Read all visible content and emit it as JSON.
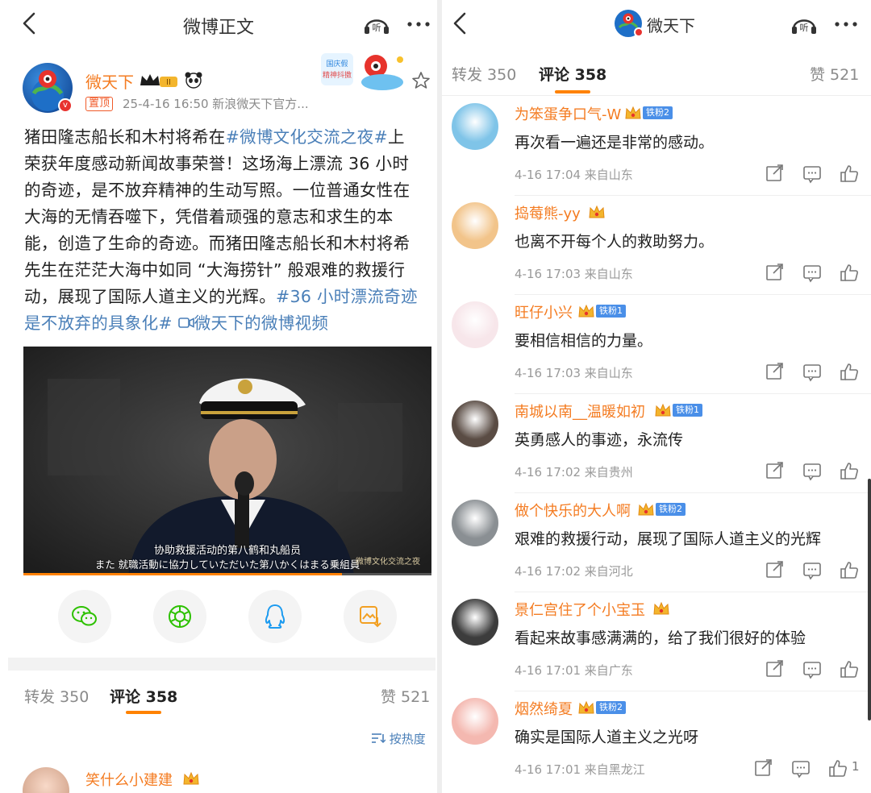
{
  "left": {
    "nav": {
      "title": "微博正文",
      "listen_label": "听"
    },
    "post": {
      "user": "微天下",
      "crown_level": "II",
      "pin_tag": "置顶",
      "meta": "25-4-16 16:50  新浪微天下官方...",
      "body_pre": "猪田隆志船长和木村将希在",
      "topic1": "#微博文化交流之夜#",
      "body_mid": "上荣获年度感动新闻故事荣誉！这场海上漂流 36 小时的奇迹，是不放弃精神的生动写照。一位普通女性在大海的无情吞噬下，凭借着顽强的意志和求生的本能，创造了生命的奇迹。而猪田隆志船长和木村将希先生在茫茫大海中如同 “大海捞针” 般艰难的救援行动，展现了国际人道主义的光辉。",
      "topic2": "#36 小时漂流奇迹是不放弃的具象化#",
      "video_link": "微天下的微博视频",
      "sticker_text": "国庆假 精神抖擞"
    },
    "video": {
      "subtitle_cn": "协助救援活动的第八鹤和丸船员",
      "subtitle_jp": "また 就職活動に協力していただいた第八かくはまる乗組員",
      "logo_text": "微博文化交流之夜",
      "progress": 0.78
    },
    "tabs": {
      "repost": "转发 350",
      "comment": "评论 358",
      "like": "赞 521"
    },
    "sort_label": "按热度",
    "first_comment_user": "笑什么小建建"
  },
  "right": {
    "nav": {
      "title": "微天下",
      "listen_label": "听"
    },
    "tabs": {
      "repost": "转发 350",
      "comment": "评论 358",
      "like": "赞 521"
    },
    "comments": [
      {
        "user": "为笨蛋争口气-W",
        "fan": "铁粉2",
        "text": "再次看一遍还是非常的感动。",
        "meta": "4-16 17:04  来自山东",
        "likes": "",
        "avatar_color": "#7fc4e8"
      },
      {
        "user": "捣莓熊-yy",
        "fan": "",
        "text": "也离不开每个人的救助努力。",
        "meta": "4-16 17:03  来自山东",
        "likes": "",
        "avatar_color": "#f2c48a"
      },
      {
        "user": "旺仔小兴",
        "fan": "铁粉1",
        "text": "要相信相信的力量。",
        "meta": "4-16 17:03  来自山东",
        "likes": "",
        "avatar_color": "#f7e6ea"
      },
      {
        "user": "南城以南__温暖如初",
        "fan": "铁粉1",
        "text": "英勇感人的事迹，永流传",
        "meta": "4-16 17:02  来自贵州",
        "likes": "",
        "avatar_color": "#5a4c44"
      },
      {
        "user": "做个快乐的大人啊",
        "fan": "铁粉2",
        "text": "艰难的救援行动，展现了国际人道主义的光辉",
        "meta": "4-16 17:02  来自河北",
        "likes": "",
        "avatar_color": "#8a8f93"
      },
      {
        "user": "景仁宫住了个小宝玉",
        "fan": "",
        "text": "看起来故事感满满的，给了我们很好的体验",
        "meta": "4-16 17:01  来自广东",
        "likes": "",
        "avatar_color": "#3c3c3c"
      },
      {
        "user": "烟然绮夏",
        "fan": "铁粉2",
        "text": "确实是国际人道主义之光呀",
        "meta": "4-16 17:01  来自黑龙江",
        "likes": "1",
        "avatar_color": "#f4b8b0"
      }
    ]
  }
}
